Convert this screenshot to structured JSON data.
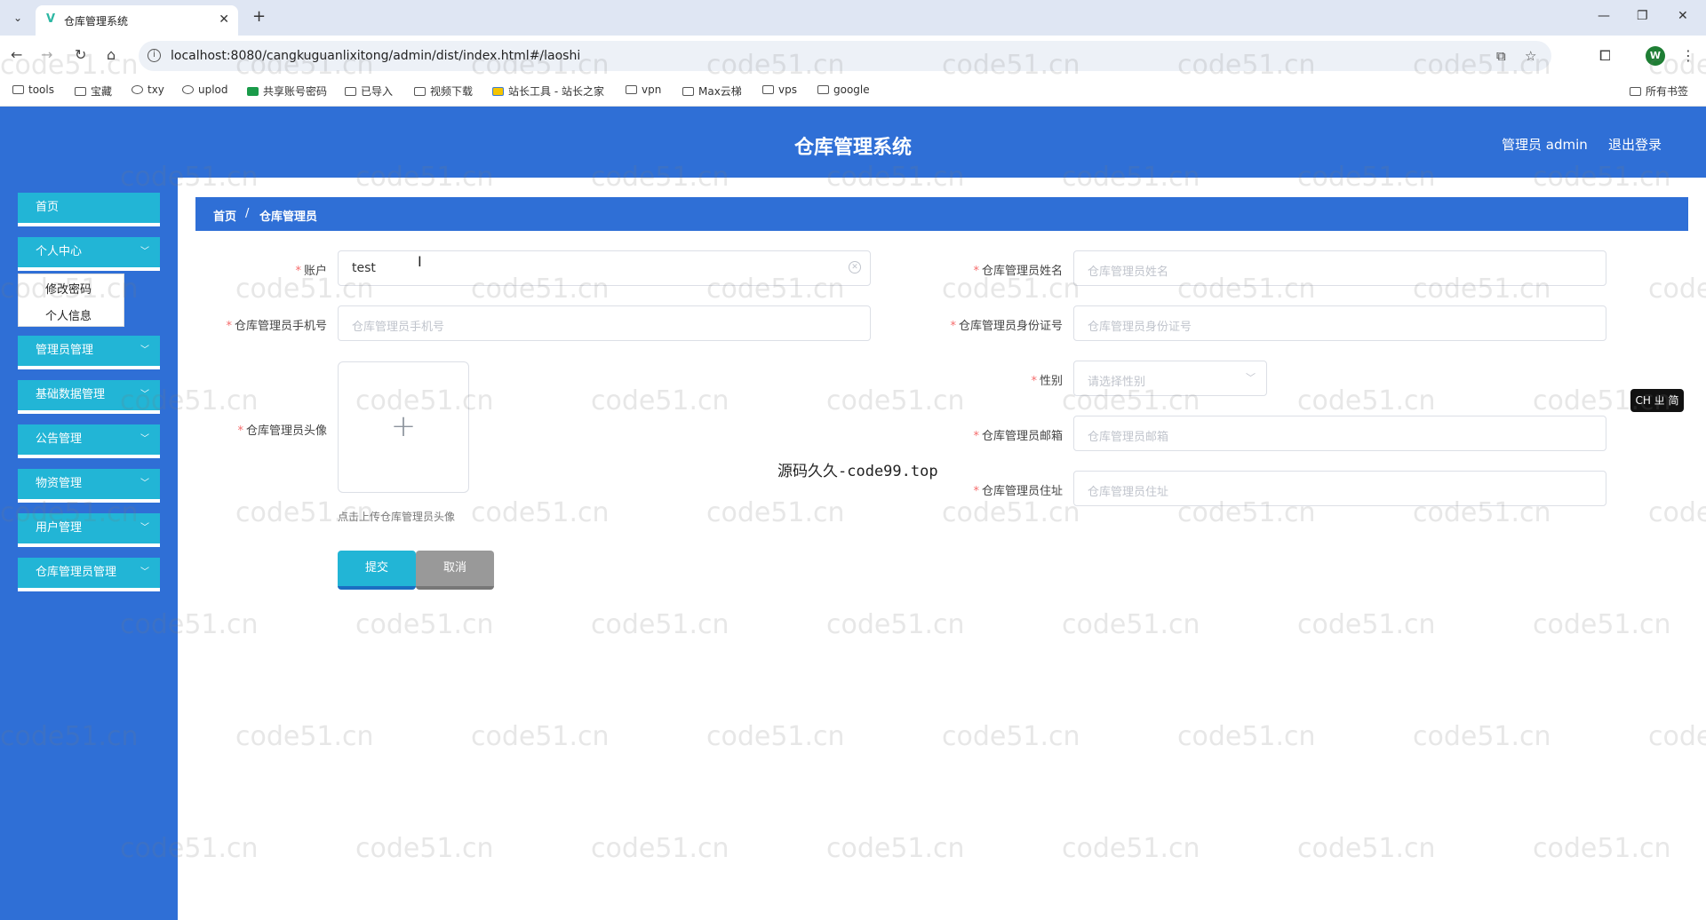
{
  "browser": {
    "tab_title": "仓库管理系统",
    "url": "localhost:8080/cangkuguanlixitong/admin/dist/index.html#/laoshi",
    "profile_initial": "W",
    "bookmarks": [
      "tools",
      "宝藏",
      "txy",
      "uplod",
      "共享账号密码",
      "已导入",
      "视频下载",
      "站长工具 - 站长之家",
      "vpn",
      "Max云梯",
      "vps",
      "google"
    ],
    "all_bookmarks": "所有书签"
  },
  "header": {
    "title": "仓库管理系统",
    "user": "管理员 admin",
    "logout": "退出登录"
  },
  "sidebar": {
    "items": [
      {
        "label": "首页"
      },
      {
        "label": "个人中心"
      },
      {
        "label": "管理员管理"
      },
      {
        "label": "基础数据管理"
      },
      {
        "label": "公告管理"
      },
      {
        "label": "物资管理"
      },
      {
        "label": "用户管理"
      },
      {
        "label": "仓库管理员管理"
      }
    ],
    "submenu": [
      "修改密码",
      "个人信息"
    ]
  },
  "breadcrumb": {
    "home": "首页",
    "separator": "/",
    "current": "仓库管理员"
  },
  "form": {
    "account": {
      "label": "账户",
      "value": "test"
    },
    "name": {
      "label": "仓库管理员姓名",
      "placeholder": "仓库管理员姓名"
    },
    "phone": {
      "label": "仓库管理员手机号",
      "placeholder": "仓库管理员手机号"
    },
    "idcard": {
      "label": "仓库管理员身份证号",
      "placeholder": "仓库管理员身份证号"
    },
    "gender": {
      "label": "性别",
      "placeholder": "请选择性别"
    },
    "avatar": {
      "label": "仓库管理员头像",
      "tip": "点击上传仓库管理员头像"
    },
    "email": {
      "label": "仓库管理员邮箱",
      "placeholder": "仓库管理员邮箱"
    },
    "address": {
      "label": "仓库管理员住址",
      "placeholder": "仓库管理员住址"
    },
    "submit": "提交",
    "cancel": "取消"
  },
  "overlay": {
    "center_watermark": "源码久久-code99.top",
    "watermark": "code51.cn",
    "ime": "CH ㄓ 简"
  }
}
